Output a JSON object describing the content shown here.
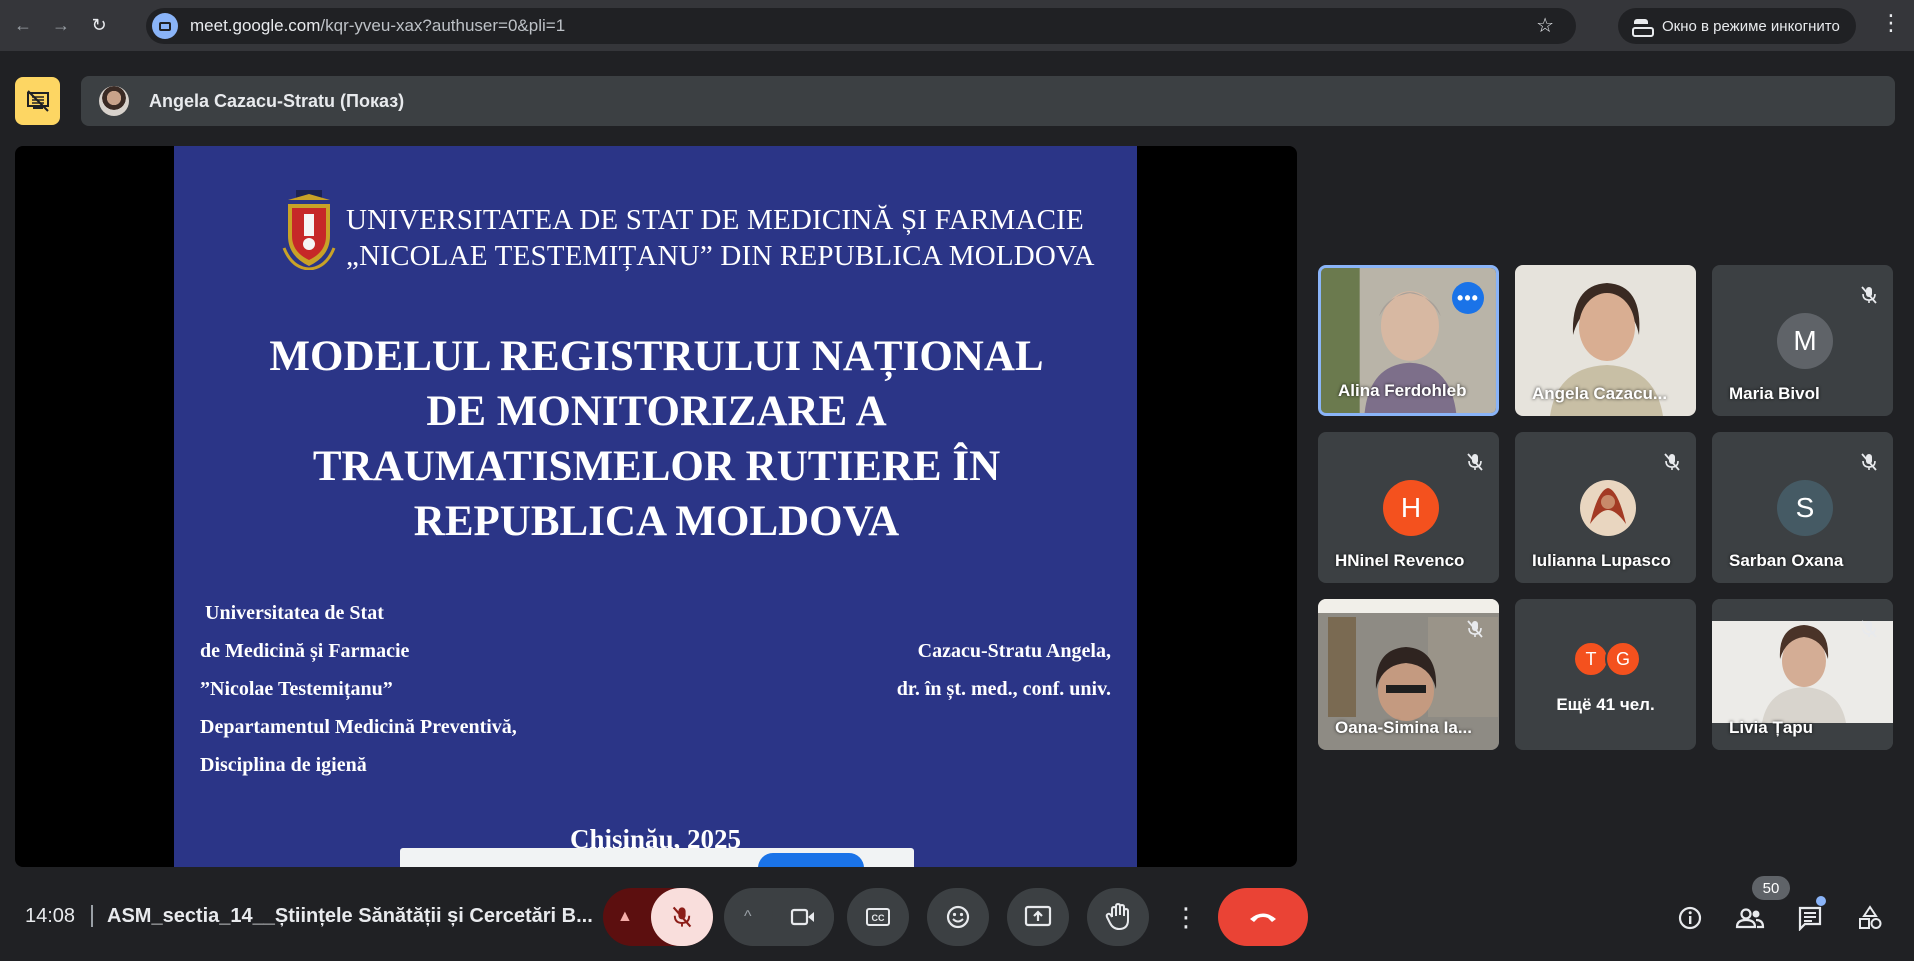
{
  "browser": {
    "url_host": "meet.google.com",
    "url_path": "/kqr-yveu-xax?authuser=0&pli=1",
    "incognito_label": "Окно в режиме инкогнито"
  },
  "presenter_bar": {
    "name": "Angela Cazacu-Stratu (Показ)"
  },
  "slide": {
    "university_line1": "UNIVERSITATEA DE STAT DE MEDICINĂ ȘI FARMACIE",
    "university_line2": "„NICOLAE TESTEMIȚANU” DIN REPUBLICA MOLDOVA",
    "title_lines": [
      "MODELUL REGISTRULUI NAȚIONAL",
      "DE MONITORIZARE A",
      "TRAUMATISMELOR RUTIERE ÎN",
      "REPUBLICA MOLDOVA"
    ],
    "left_lines": [
      "Universitatea de Stat",
      "de Medicină și Farmacie",
      "”Nicolae Testemițanu”",
      "Departamentul Medicină Preventivă,",
      "Disciplina de igienă"
    ],
    "right_lines": [
      "Cazacu-Stratu Angela,",
      "dr. în șt. med., conf. univ."
    ],
    "city": "Chișinău, 2025"
  },
  "participants": [
    {
      "name": "Alina Ferdohleb",
      "type": "video",
      "speaking": true,
      "muted": false
    },
    {
      "name": "Angela Cazacu...",
      "type": "video",
      "speaking": false,
      "muted": false
    },
    {
      "name": "Maria Bivol",
      "type": "avatar",
      "initial": "M",
      "color": "#5f6368",
      "muted": true
    },
    {
      "name": "HNinel Revenco",
      "type": "avatar",
      "initial": "H",
      "color": "#f4511e",
      "muted": true
    },
    {
      "name": "Iulianna Lupasco",
      "type": "photo",
      "muted": true
    },
    {
      "name": "Sarban Oxana",
      "type": "avatar",
      "initial": "S",
      "color": "#455a64",
      "muted": true
    },
    {
      "name": "Oana-Simina Ia...",
      "type": "video",
      "muted": true
    },
    {
      "name": "Ещё 41 чел.",
      "type": "more",
      "initials": [
        "T",
        "G"
      ]
    },
    {
      "name": "Livia Țapu",
      "type": "video",
      "muted": true
    }
  ],
  "controls": {
    "time": "14:08",
    "meeting_name": "ASM_sectia_14__Științele Sănătății și Cercetări B...",
    "participant_count": "50"
  },
  "colors": {
    "background": "#202124",
    "tile": "#3c4043",
    "slide": "#2b3587",
    "end_call": "#ea4335",
    "speaking_border": "#8ab4f8",
    "present_icon": "#fdd663"
  }
}
